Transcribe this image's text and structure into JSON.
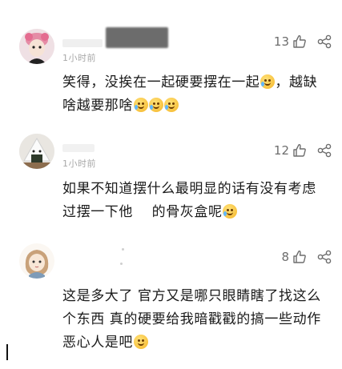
{
  "comments": [
    {
      "time": "1小时前",
      "likes": "13",
      "text": "笑得，没挨在一起硬要摆在一起",
      "text_mid": "，越缺啥越要那啥",
      "avatar_icon": "pink-hair-avatar"
    },
    {
      "time": "1小时前",
      "likes": "12",
      "text": "如果不知道摆什么最明显的话有没有考虑过摆一下他　 的骨灰盒呢",
      "avatar_icon": "rice-ball-avatar"
    },
    {
      "likes": "8",
      "text": "这是多大了 官方又是哪只眼睛瞎了找这么个东西 真的硬要给我暗戳戳的搞一些动作恶心人是吧",
      "avatar_icon": "cartoon-girl-avatar"
    }
  ],
  "colors": {
    "text": "#1a1a1a",
    "meta": "#a8a8a8",
    "icon": "#6d6d6d"
  }
}
